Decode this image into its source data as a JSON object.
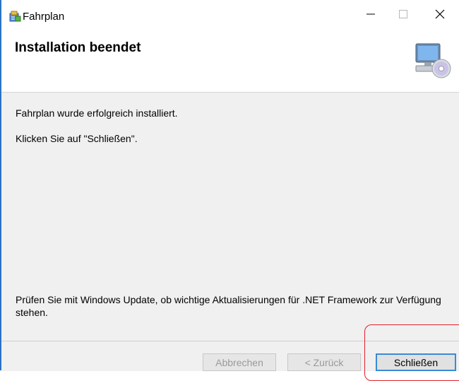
{
  "window": {
    "title": "Fahrplan",
    "icons": {
      "app": "installer-package-icon",
      "minimize": "minimize-icon",
      "maximize": "maximize-icon",
      "close": "close-icon"
    }
  },
  "banner": {
    "title": "Installation beendet",
    "icon": "computer-cd-icon"
  },
  "content": {
    "message_success": "Fahrplan wurde erfolgreich installiert.",
    "message_instruction": "Klicken Sie auf \"Schließen\".",
    "message_update": "Prüfen Sie mit Windows Update, ob wichtige Aktualisierungen für .NET Framework zur Verfügung stehen."
  },
  "footer": {
    "cancel_label": "Abbrechen",
    "back_label": "< Zurück",
    "close_label": "Schließen"
  },
  "colors": {
    "accent": "#3a8ad6",
    "highlight": "#e0202a",
    "disabled_text": "#9a9a9a"
  }
}
